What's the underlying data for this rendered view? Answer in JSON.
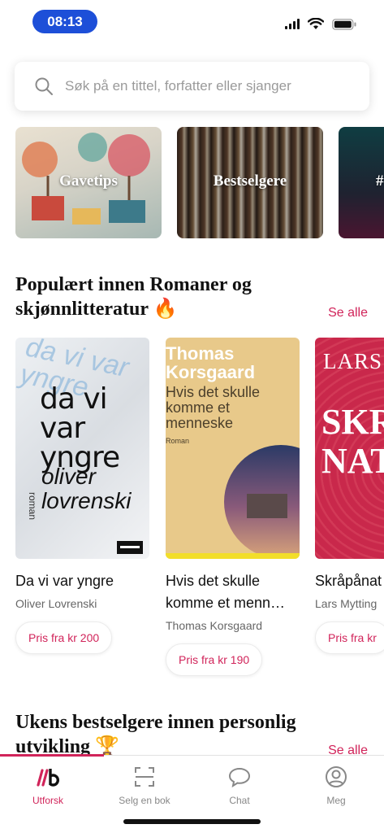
{
  "status_bar": {
    "time": "08:13"
  },
  "search": {
    "placeholder": "Søk på en tittel, forfatter eller sjanger"
  },
  "categories": [
    {
      "label": "Gavetips"
    },
    {
      "label": "Bestselgere"
    },
    {
      "label": "#"
    }
  ],
  "section_popular": {
    "title": "Populært innen Romaner og skjønnlitteratur 🔥",
    "see_all": "Se alle"
  },
  "books": [
    {
      "title": "Da vi var yngre",
      "author": "Oliver Lovrenski",
      "price": "Pris fra kr 200",
      "cover": {
        "title": "da vi var yngre",
        "author": "oliver lovrenski",
        "genre": "roman",
        "bg_text": "da vi var yngre"
      }
    },
    {
      "title": "Hvis det skulle komme et menn…",
      "author": "Thomas Korsgaard",
      "price": "Pris fra kr 190",
      "cover": {
        "author": "Thomas Korsgaard",
        "title": "Hvis det skulle komme et menneske",
        "genre": "Roman"
      }
    },
    {
      "title": "Skråpånat",
      "author": "Lars Mytting",
      "price": "Pris fra kr",
      "cover": {
        "author": "LARS M",
        "title": "SKR NAT"
      }
    }
  ],
  "section_bestsellers": {
    "title": "Ukens bestselgere innen personlig utvikling 🏆",
    "see_all": "Se alle"
  },
  "bottom_nav": [
    {
      "label": "Utforsk",
      "icon": "brand-logo-icon",
      "active": true
    },
    {
      "label": "Selg en bok",
      "icon": "scan-icon",
      "active": false
    },
    {
      "label": "Chat",
      "icon": "chat-bubble-icon",
      "active": false
    },
    {
      "label": "Meg",
      "icon": "profile-icon",
      "active": false
    }
  ],
  "colors": {
    "accent": "#d1245a",
    "time_pill": "#1d4fd8"
  }
}
